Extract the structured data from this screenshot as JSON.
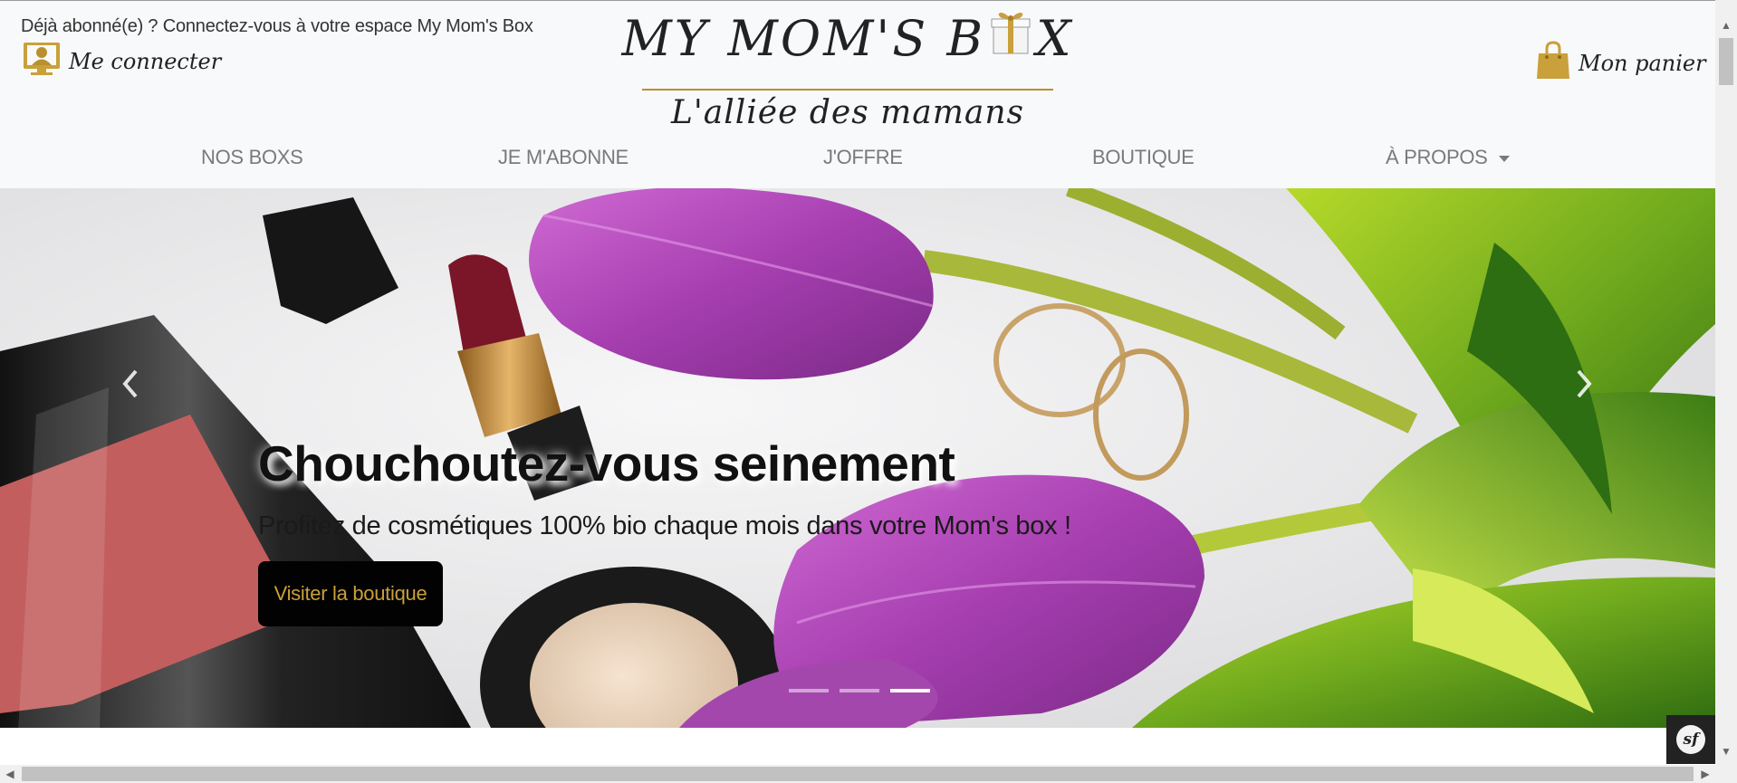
{
  "header": {
    "already_subscribed": "Déjà abonné(e) ? Connectez-vous à votre espace My Mom's Box",
    "login_label": "Me connecter",
    "brand_left": "MY MOM'S B",
    "brand_right": "X",
    "tagline": "L'alliée des mamans",
    "cart_label": "Mon panier"
  },
  "nav": {
    "items": [
      "NOS BOXS",
      "JE M'ABONNE",
      "J'OFFRE",
      "BOUTIQUE",
      "À PROPOS"
    ]
  },
  "hero": {
    "title": "Chouchoutez-vous seinement",
    "subtitle": "Profitez de cosmétiques 100% bio chaque mois dans votre Mom's box !",
    "button_label": "Visiter la boutique",
    "indicator_count": 3,
    "active_indicator": 3
  },
  "footer_badge": {
    "text": "sf"
  },
  "colors": {
    "gold": "#b9902d",
    "nav_text": "#7a7a7a",
    "button_bg": "#020202",
    "button_text": "#c9a03a",
    "header_bg": "#f8f9fa"
  },
  "icons": [
    "user-monitor-icon",
    "gift-box-icon",
    "shopping-bag-icon",
    "chevron-left-icon",
    "chevron-right-icon",
    "caret-down-icon"
  ]
}
